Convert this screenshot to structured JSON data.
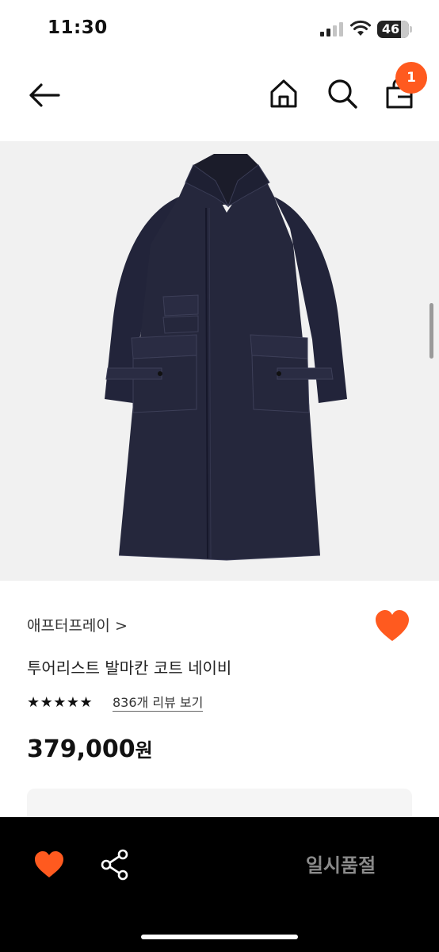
{
  "status_bar": {
    "time": "11:30",
    "battery": "46",
    "battery_level": 0.46
  },
  "nav": {
    "cart_badge": "1"
  },
  "product": {
    "brand": "애프터프레이",
    "brand_chevron": ">",
    "name": "투어리스트 발마칸 코트 네이비",
    "stars": "★★★★★",
    "rating": 5,
    "review_link": "836개 리뷰 보기",
    "price": "379,000",
    "price_unit": "원",
    "wishlisted": true
  },
  "bottom_bar": {
    "sold_out_label": "일시품절"
  },
  "colors": {
    "accent": "#ff5a1f",
    "coat": "#23253a",
    "image_bg": "#f1f1f1"
  },
  "icons": [
    "back-arrow-icon",
    "home-icon",
    "search-icon",
    "shopping-bag-icon",
    "heart-icon",
    "share-icon"
  ]
}
